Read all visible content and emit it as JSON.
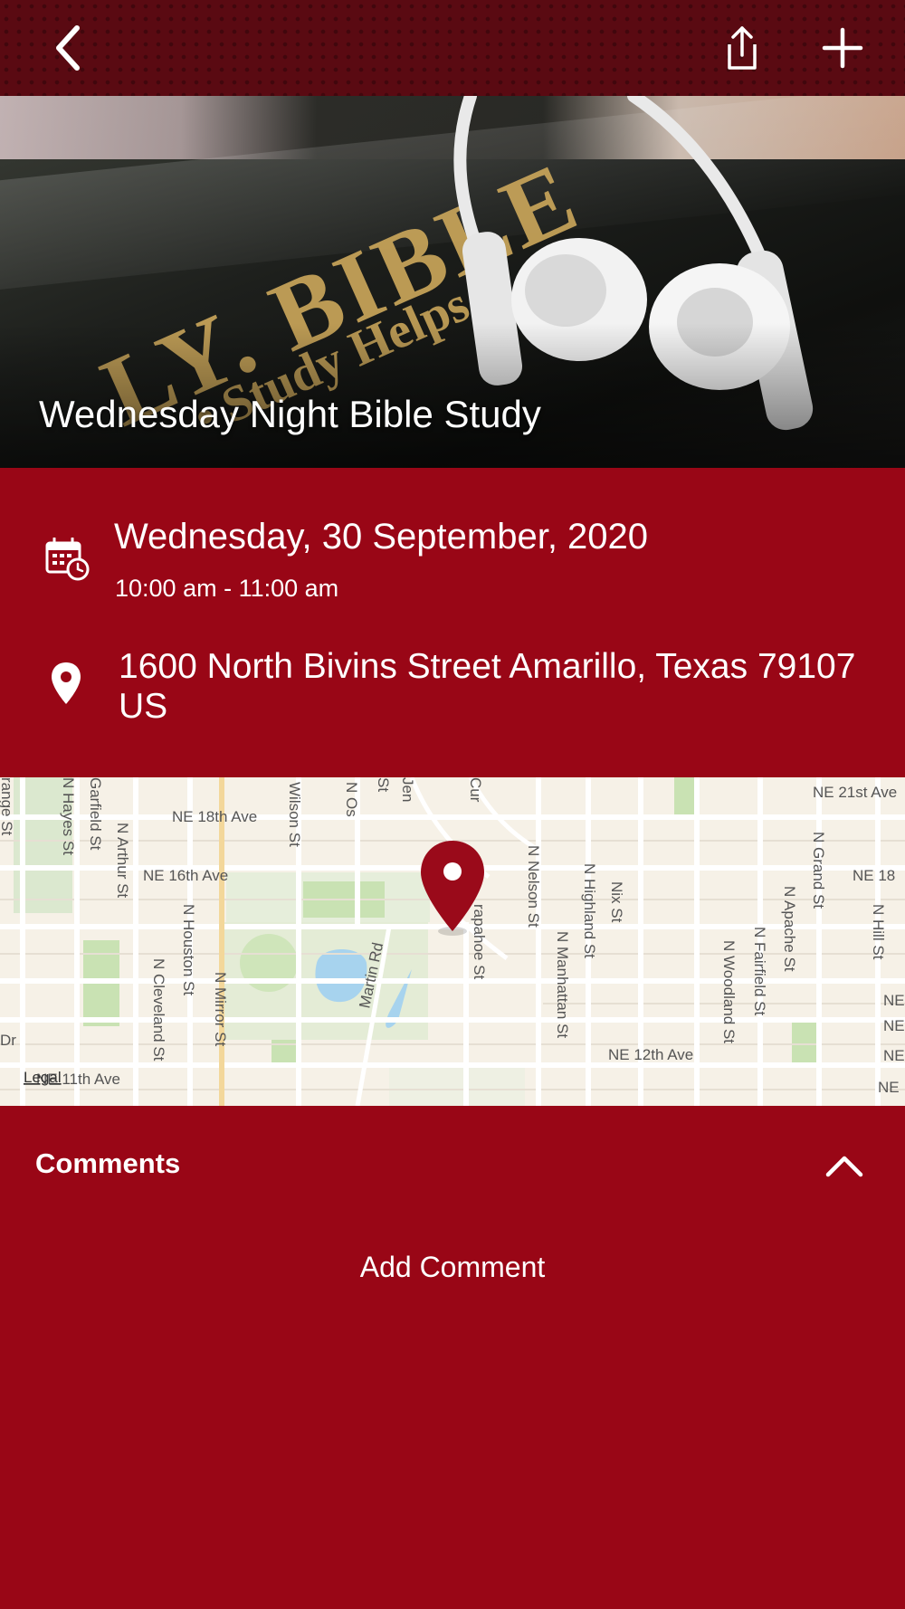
{
  "header": {
    "back_icon": "chevron-left-icon",
    "share_icon": "share-icon",
    "add_icon": "plus-icon",
    "bar_color": "#5a0a12"
  },
  "hero": {
    "title": "Wednesday Night Bible Study",
    "image_text_line1": "LY. BIBLE",
    "image_text_line2": "• Study Helps"
  },
  "event": {
    "date": "Wednesday, 30 September, 2020",
    "time": "10:00 am - 11:00 am",
    "address": "1600 North Bivins Street Amarillo, Texas 79107 US",
    "date_icon": "calendar-clock-icon",
    "location_icon": "location-pin-icon"
  },
  "map": {
    "legal_label": "Legal",
    "pin_icon": "map-pin-icon",
    "street_labels": [
      "NE 21st Ave",
      "NE 18th Ave",
      "NE 16th Ave",
      "NE 18",
      "NE 12th Ave",
      "NE 11th Ave",
      "N Hayes St",
      "Garfield St",
      "N Arthur St",
      "Wilson St",
      "N Os",
      "St",
      "Jen",
      "Cur",
      "N Nelson St",
      "N Highland St",
      "Nix St",
      "N Grand St",
      "N Apache St",
      "N Hill St",
      "N Houston St",
      "N Cleveland St",
      "N Mirror St",
      "Martin Rd",
      "rapahoe St",
      "N Manhattan St",
      "N Woodland St",
      "N Fairfield St",
      "range St",
      "Dr",
      "NE",
      "NE",
      "NE",
      "NE"
    ]
  },
  "comments": {
    "title": "Comments",
    "toggle_icon": "chevron-up-icon",
    "add_label": "Add Comment"
  },
  "colors": {
    "background": "#990616",
    "accent": "#990616",
    "text": "#ffffff"
  }
}
